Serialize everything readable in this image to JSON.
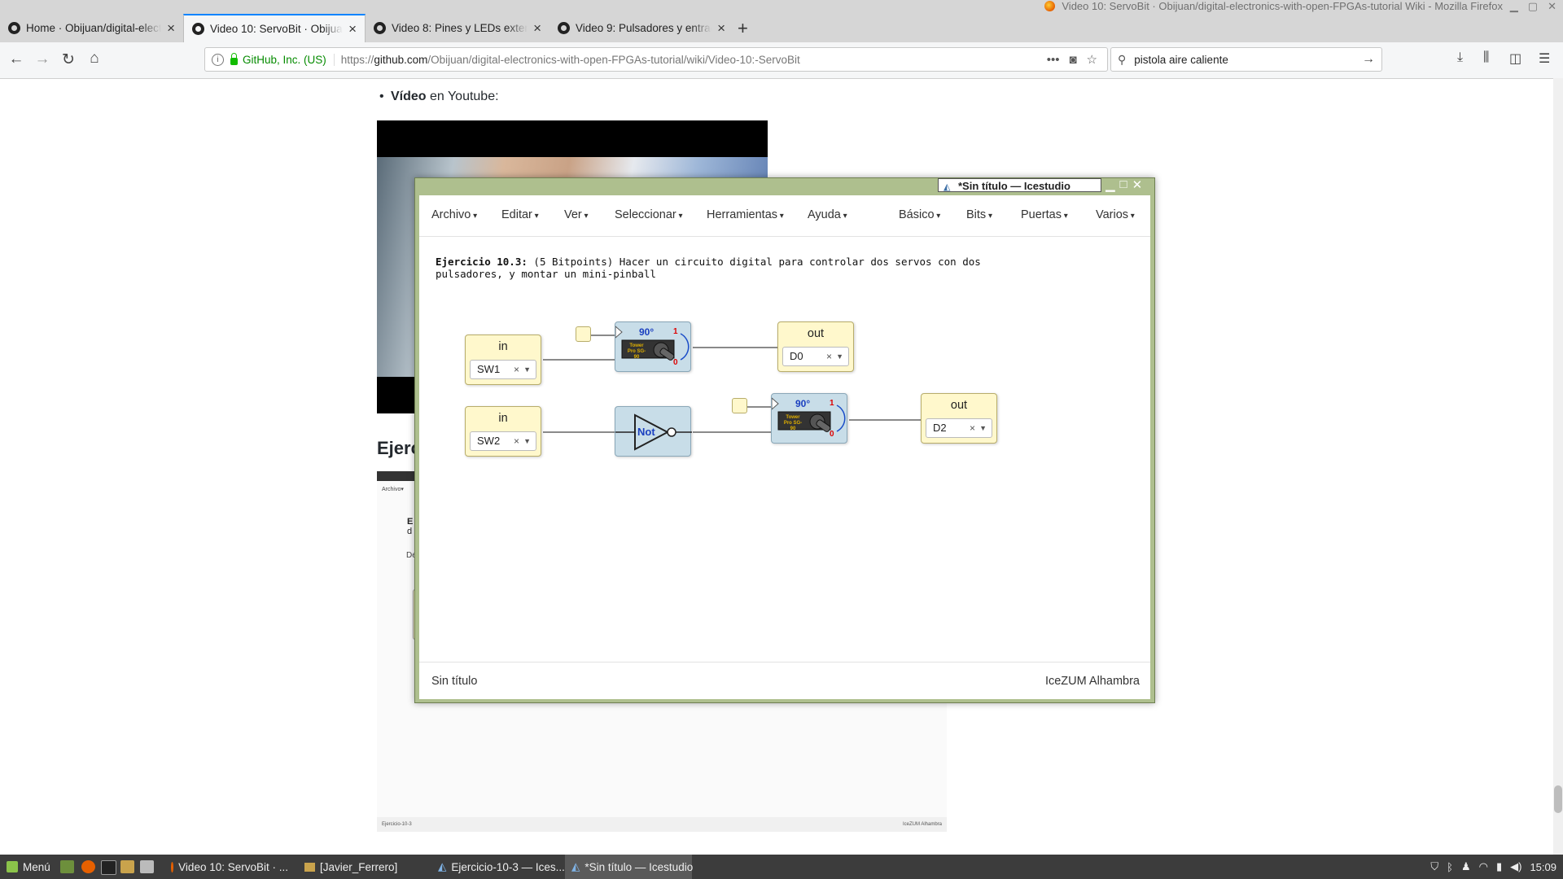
{
  "browser": {
    "window_title": "Video 10: ServoBit · Obijuan/digital-electronics-with-open-FPGAs-tutorial Wiki - Mozilla Firefox",
    "tabs": [
      {
        "label": "Home · Obijuan/digital-electronics-with-open-FPGAs-tutorial Wiki",
        "active": false
      },
      {
        "label": "Video 10: ServoBit · Obijuan/digital-electronics-with-open-FPGAs-tutorial",
        "active": true
      },
      {
        "label": "Video 8: Pines y LEDs externos",
        "active": false
      },
      {
        "label": "Video 9: Pulsadores y entradas",
        "active": false
      }
    ],
    "new_tab": "+",
    "site_identity": "GitHub, Inc. (US)",
    "url_prefix": "https://",
    "url_host": "github.com",
    "url_path": "/Obijuan/digital-electronics-with-open-FPGAs-tutorial/wiki/Video-10:-ServoBit",
    "search_value": "pistola aire caliente"
  },
  "page": {
    "bullet_bold": "Vídeo",
    "bullet_rest": " en Youtube:",
    "heading_fragment": "Ejerc",
    "embed_menu": "Archivo▾",
    "embed_text_1": "E",
    "embed_text_2": "d",
    "embed_text_3": "De",
    "embed_footer_left": "Ejercicio-10-3",
    "embed_footer_right": "IceZUM Alhambra"
  },
  "icestudio": {
    "title": "*Sin título — Icestudio",
    "menus_left": [
      "Archivo",
      "Editar",
      "Ver",
      "Seleccionar",
      "Herramientas",
      "Ayuda"
    ],
    "menus_right": [
      "Básico",
      "Bits",
      "Puertas",
      "Varios"
    ],
    "exercise_bold": "Ejercicio 10.3:",
    "exercise_text": " (5 Bitpoints) Hacer un circuito digital para controlar dos servos con dos pulsadores, y montar un mini-pinball",
    "blocks": {
      "in1": {
        "label": "in",
        "pin": "SW1"
      },
      "in2": {
        "label": "in",
        "pin": "SW2"
      },
      "out1": {
        "label": "out",
        "pin": "D0"
      },
      "out2": {
        "label": "out",
        "pin": "D2"
      },
      "servo_angle": "90°",
      "servo_hi": "1",
      "servo_lo": "0",
      "servo_brand": "Tower Pro SG-90",
      "not_label": "Not"
    },
    "clear_symbol": "×",
    "status_left": "Sin título",
    "status_right": "IceZUM Alhambra"
  },
  "taskbar": {
    "menu_label": "Menú",
    "items": [
      {
        "label": "Video 10: ServoBit · ...",
        "active": false
      },
      {
        "label": "[Javier_Ferrero]",
        "active": false
      },
      {
        "label": "Ejercicio-10-3 — Ices...",
        "active": false
      },
      {
        "label": "*Sin título — Icestudio",
        "active": true
      }
    ],
    "clock": "15:09"
  },
  "colors": {
    "ice_frame": "#aebf8e",
    "io_block": "#fff8cc",
    "servo_block": "#c8dde8",
    "url_secure": "#058b00"
  }
}
